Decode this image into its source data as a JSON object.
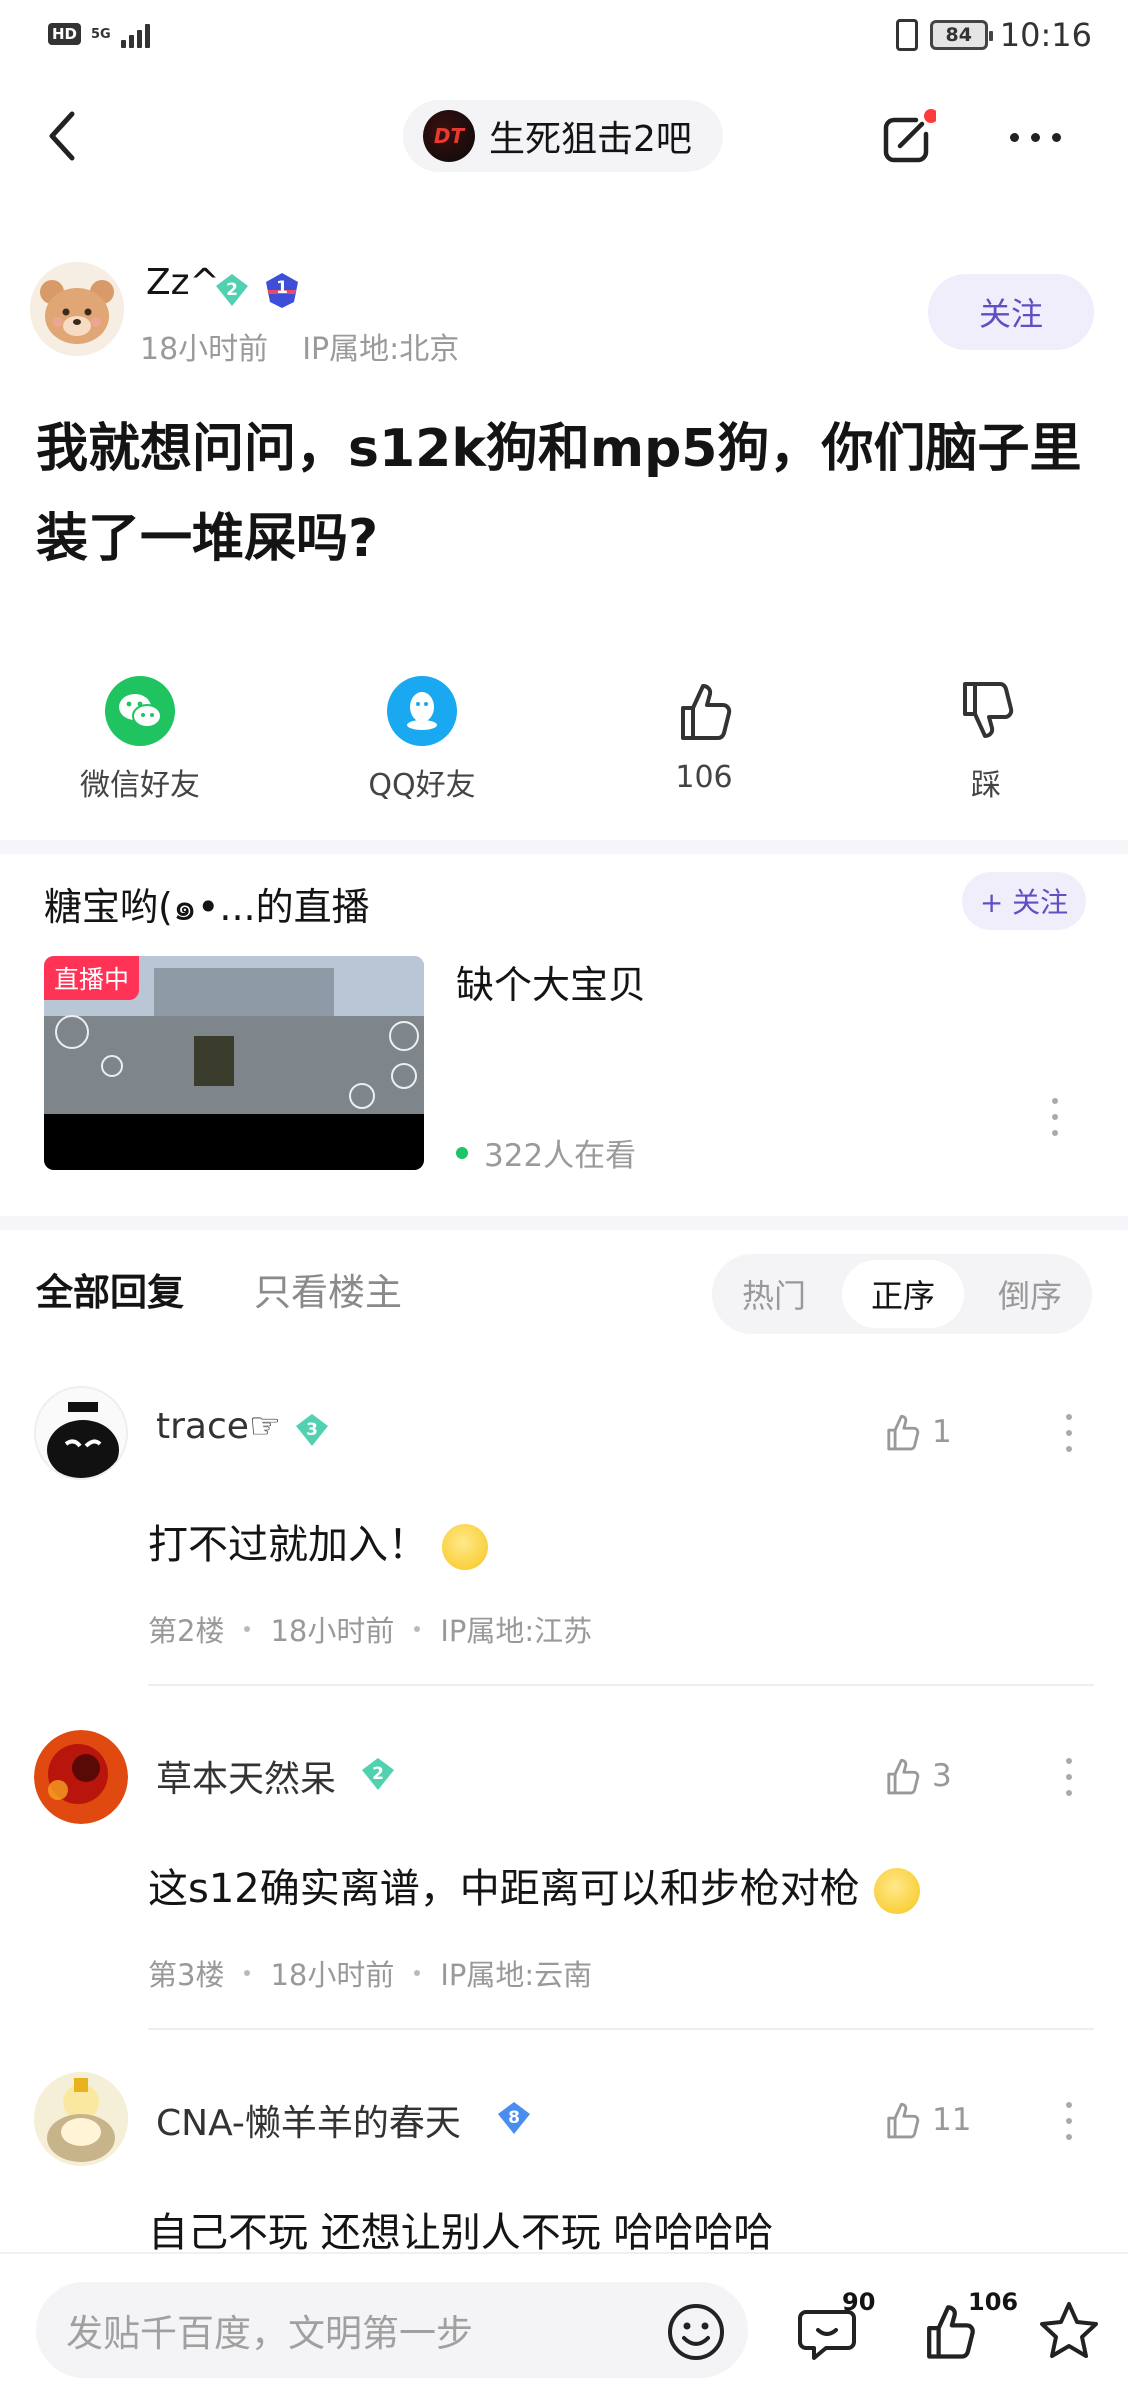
{
  "status_bar": {
    "hd": "HD",
    "network": "5G",
    "battery": "84",
    "time": "10:16"
  },
  "nav": {
    "forum_name": "生死狙击2吧",
    "forum_logo_text": "DT"
  },
  "post": {
    "author": "Zz^",
    "author_level": "2",
    "author_rank": "1",
    "time": "18小时前",
    "ip": "IP属地:北京",
    "follow_label": "关注",
    "title": "我就想问问，s12k狗和mp5狗，你们脑子里装了一堆屎吗?"
  },
  "share": {
    "wechat": "微信好友",
    "qq": "QQ好友",
    "likes": "106",
    "dislike": "踩"
  },
  "live": {
    "header": "糖宝哟(๑•...的直播",
    "follow_label": "+ 关注",
    "badge": "直播中",
    "stream_title": "缺个大宝贝",
    "viewers": "322人在看"
  },
  "replies_tabs": {
    "all": "全部回复",
    "host_only": "只看楼主",
    "sort_hot": "热门",
    "sort_asc": "正序",
    "sort_desc": "倒序"
  },
  "comments": [
    {
      "name": "trace☞",
      "level": "3",
      "likes": "1",
      "text": "打不过就加入！",
      "floor": "第2楼",
      "time": "18小时前",
      "ip": "IP属地:江苏"
    },
    {
      "name": "草本天然呆",
      "level": "2",
      "likes": "3",
      "text": "这s12确实离谱，中距离可以和步枪对枪",
      "floor": "第3楼",
      "time": "18小时前",
      "ip": "IP属地:云南"
    },
    {
      "name": "CNA-懒羊羊的春天",
      "level": "8",
      "likes": "11",
      "text": "自己不玩 还想让别人不玩 哈哈哈哈"
    }
  ],
  "bottom_bar": {
    "placeholder": "发贴千百度，文明第一步",
    "comment_count": "90",
    "like_count": "106"
  },
  "colors": {
    "accent": "#614ec2",
    "accent_bg": "#f1eefc",
    "wechat": "#1fc461",
    "qq": "#1aa8f0",
    "live_badge": "#ff3355"
  }
}
